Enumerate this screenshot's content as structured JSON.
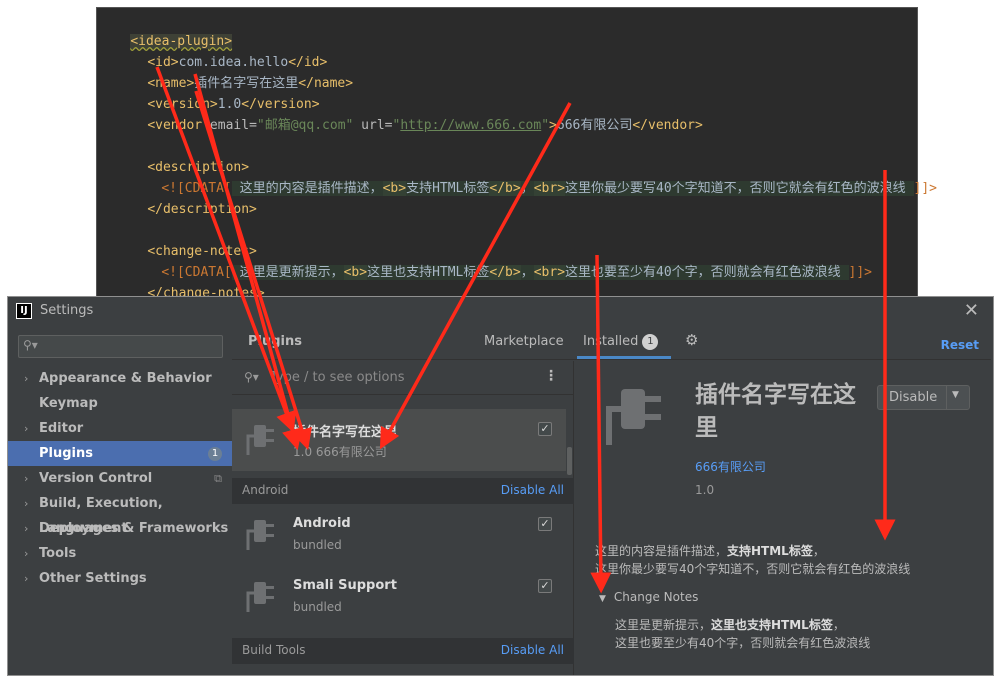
{
  "editor": {
    "line1": "<idea-plugin>",
    "id_open": "<id>",
    "id_value": "com.idea.hello",
    "id_close": "</id>",
    "name_open": "<name>",
    "name_value": "插件名字写在这里",
    "name_close": "</name>",
    "version_open": "<version>",
    "version_value": "1.0",
    "version_close": "</version>",
    "vendor_open": "<vendor",
    "vendor_email_attr": " email=",
    "vendor_email_val": "\"邮箱@qq.com\"",
    "vendor_url_attr": " url=",
    "vendor_url_q1": "\"",
    "vendor_url_val": "http://www.666.com",
    "vendor_url_q2": "\"",
    "vendor_gt": ">",
    "vendor_value": "666有限公司",
    "vendor_close": "</vendor>",
    "desc_open": "<description>",
    "desc_cdata_start": "<![CDATA[",
    "desc_t1": " 这里的内容是插件描述，",
    "desc_b_open": "<b>",
    "desc_t2": "支持HTML标签",
    "desc_b_close": "</b>",
    "desc_t3": "，",
    "desc_br": "<br>",
    "desc_t4": "这里你最少要写40个字知道不，否则它就会有红色的波浪线 ",
    "desc_cdata_end": "]]>",
    "desc_close": "</description>",
    "notes_open": "<change-notes>",
    "notes_cdata_start": "<![CDATA[",
    "notes_t1": " 这里是更新提示，",
    "notes_b_open": "<b>",
    "notes_t2": "这里也支持HTML标签",
    "notes_b_close": "</b>",
    "notes_t3": "，",
    "notes_br": "<br>",
    "notes_t4": "这里也要至少有40个字，否则就会有红色波浪线 ",
    "notes_cdata_end": "]]>",
    "notes_close": "</change-notes>"
  },
  "window": {
    "title": "Settings",
    "app_icon": "IJ"
  },
  "sidebar": {
    "items": [
      {
        "label": "Appearance & Behavior",
        "chevron": "›"
      },
      {
        "label": "Keymap",
        "chevron": ""
      },
      {
        "label": "Editor",
        "chevron": "›"
      },
      {
        "label": "Plugins",
        "chevron": "",
        "badge": "1"
      },
      {
        "label": "Version Control",
        "chevron": "›"
      },
      {
        "label": "Build, Execution, Deployment",
        "chevron": "›"
      },
      {
        "label": "Languages & Frameworks",
        "chevron": "›"
      },
      {
        "label": "Tools",
        "chevron": "›"
      },
      {
        "label": "Other Settings",
        "chevron": "›"
      }
    ]
  },
  "header": {
    "title": "Plugins",
    "tab_marketplace": "Marketplace",
    "tab_installed": "Installed",
    "installed_count": "1",
    "reset": "Reset"
  },
  "list": {
    "search_placeholder": "Type / to see options",
    "plugins": [
      {
        "name": "插件名字写在这里",
        "sub": "1.0  666有限公司",
        "checked": true
      },
      {
        "name": "Android",
        "sub": "bundled",
        "checked": true
      },
      {
        "name": "Smali Support",
        "sub": "bundled",
        "checked": true
      }
    ],
    "sections": [
      {
        "name": "Android",
        "action": "Disable All"
      },
      {
        "name": "Build Tools",
        "action": "Disable All"
      }
    ]
  },
  "detail": {
    "name": "插件名字写在这里",
    "disable_label": "Disable",
    "vendor": "666有限公司",
    "version": "1.0",
    "desc_line1_plain": "这里的内容是插件描述，",
    "desc_line1_bold": "支持HTML标签",
    "desc_line1_end": "，",
    "desc_line2": "这里你最少要写40个字知道不，否则它就会有红色的波浪线",
    "change_notes_label": "Change Notes",
    "notes_line1_plain": "这里是更新提示，",
    "notes_line1_bold": "这里也支持HTML标签",
    "notes_line1_end": "，",
    "notes_line2": "这里也要至少有40个字，否则就会有红色波浪线"
  },
  "colors": {
    "accent": "#4b6eaf",
    "link": "#589df6",
    "annotation_arrow": "#ff2a1a",
    "editor_bg": "#2b2b2b",
    "dialog_bg": "#3c3f41"
  }
}
